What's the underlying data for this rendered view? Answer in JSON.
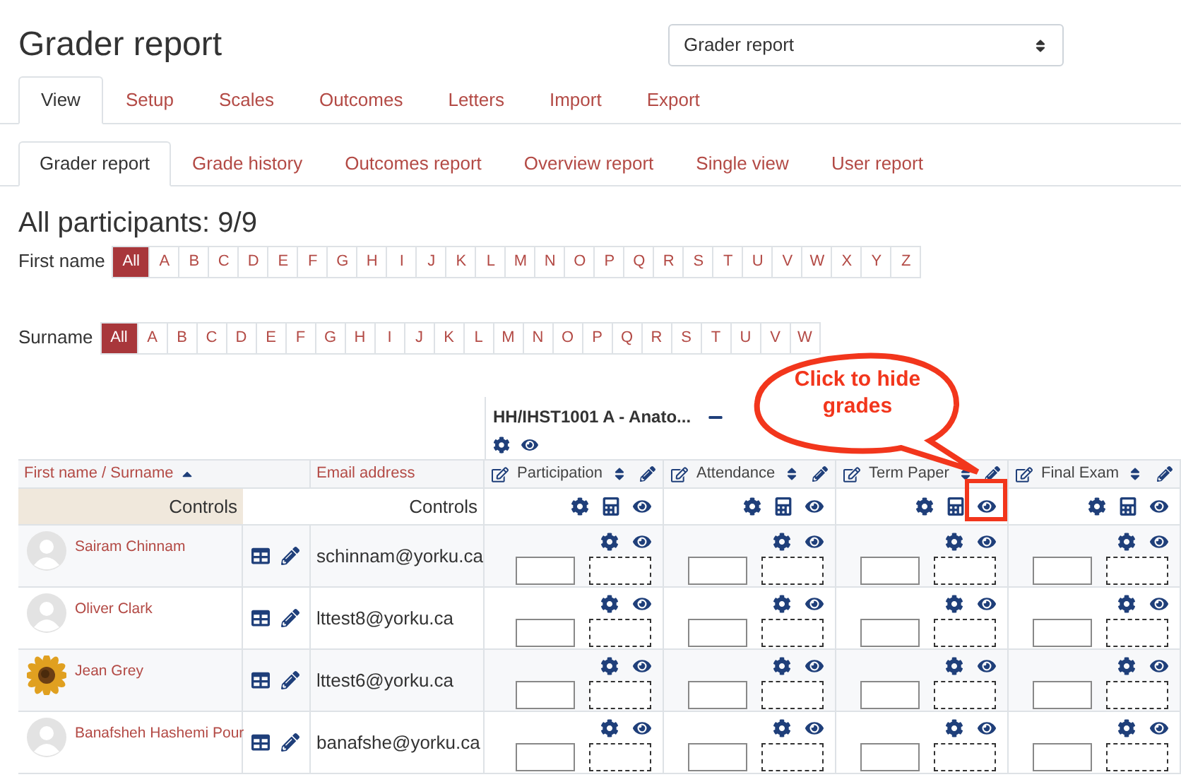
{
  "page_title": "Grader report",
  "report_select": {
    "value": "Grader report"
  },
  "main_tabs": [
    {
      "label": "View",
      "selected": true
    },
    {
      "label": "Setup",
      "selected": false
    },
    {
      "label": "Scales",
      "selected": false
    },
    {
      "label": "Outcomes",
      "selected": false
    },
    {
      "label": "Letters",
      "selected": false
    },
    {
      "label": "Import",
      "selected": false
    },
    {
      "label": "Export",
      "selected": false
    }
  ],
  "sub_tabs": [
    {
      "label": "Grader report",
      "selected": true
    },
    {
      "label": "Grade history",
      "selected": false
    },
    {
      "label": "Outcomes report",
      "selected": false
    },
    {
      "label": "Overview report",
      "selected": false
    },
    {
      "label": "Single view",
      "selected": false
    },
    {
      "label": "User report",
      "selected": false
    }
  ],
  "participants_heading": "All participants: 9/9",
  "first_name_filter": {
    "label": "First name",
    "letters": [
      {
        "label": "All",
        "selected": true
      },
      {
        "label": "A",
        "selected": false
      },
      {
        "label": "B",
        "selected": false
      },
      {
        "label": "C",
        "selected": false
      },
      {
        "label": "D",
        "selected": false
      },
      {
        "label": "E",
        "selected": false
      },
      {
        "label": "F",
        "selected": false
      },
      {
        "label": "G",
        "selected": false
      },
      {
        "label": "H",
        "selected": false
      },
      {
        "label": "I",
        "selected": false
      },
      {
        "label": "J",
        "selected": false
      },
      {
        "label": "K",
        "selected": false
      },
      {
        "label": "L",
        "selected": false
      },
      {
        "label": "M",
        "selected": false
      },
      {
        "label": "N",
        "selected": false
      },
      {
        "label": "O",
        "selected": false
      },
      {
        "label": "P",
        "selected": false
      },
      {
        "label": "Q",
        "selected": false
      },
      {
        "label": "R",
        "selected": false
      },
      {
        "label": "S",
        "selected": false
      },
      {
        "label": "T",
        "selected": false
      },
      {
        "label": "U",
        "selected": false
      },
      {
        "label": "V",
        "selected": false
      },
      {
        "label": "W",
        "selected": false
      },
      {
        "label": "X",
        "selected": false
      },
      {
        "label": "Y",
        "selected": false
      },
      {
        "label": "Z",
        "selected": false
      }
    ]
  },
  "surname_filter": {
    "label": "Surname",
    "letters": [
      {
        "label": "All",
        "selected": true
      },
      {
        "label": "A",
        "selected": false
      },
      {
        "label": "B",
        "selected": false
      },
      {
        "label": "C",
        "selected": false
      },
      {
        "label": "D",
        "selected": false
      },
      {
        "label": "E",
        "selected": false
      },
      {
        "label": "F",
        "selected": false
      },
      {
        "label": "G",
        "selected": false
      },
      {
        "label": "H",
        "selected": false
      },
      {
        "label": "I",
        "selected": false
      },
      {
        "label": "J",
        "selected": false
      },
      {
        "label": "K",
        "selected": false
      },
      {
        "label": "L",
        "selected": false
      },
      {
        "label": "M",
        "selected": false
      },
      {
        "label": "N",
        "selected": false
      },
      {
        "label": "O",
        "selected": false
      },
      {
        "label": "P",
        "selected": false
      },
      {
        "label": "Q",
        "selected": false
      },
      {
        "label": "R",
        "selected": false
      },
      {
        "label": "S",
        "selected": false
      },
      {
        "label": "T",
        "selected": false
      },
      {
        "label": "U",
        "selected": false
      },
      {
        "label": "V",
        "selected": false
      },
      {
        "label": "W",
        "selected": false
      }
    ]
  },
  "course_header": {
    "title": "HH/IHST1001 A - Anato..."
  },
  "columns": {
    "name": "First name / Surname",
    "email": "Email address"
  },
  "controls_labels": [
    "Controls",
    "Controls"
  ],
  "grade_items": [
    {
      "name": "Participation"
    },
    {
      "name": "Attendance"
    },
    {
      "name": "Term Paper"
    },
    {
      "name": "Final Exam"
    }
  ],
  "students": [
    {
      "name": "Sairam Chinnam",
      "email": "schinnam@yorku.ca",
      "kind": "default"
    },
    {
      "name": "Oliver Clark",
      "email": "lttest8@yorku.ca",
      "kind": "default"
    },
    {
      "name": "Jean Grey",
      "email": "lttest6@yorku.ca",
      "kind": "picture"
    },
    {
      "name": "Banafsheh Hashemi Pour",
      "email": "banafshe@yorku.ca",
      "kind": "default"
    }
  ],
  "callout": {
    "text": "Click to hide grades"
  }
}
